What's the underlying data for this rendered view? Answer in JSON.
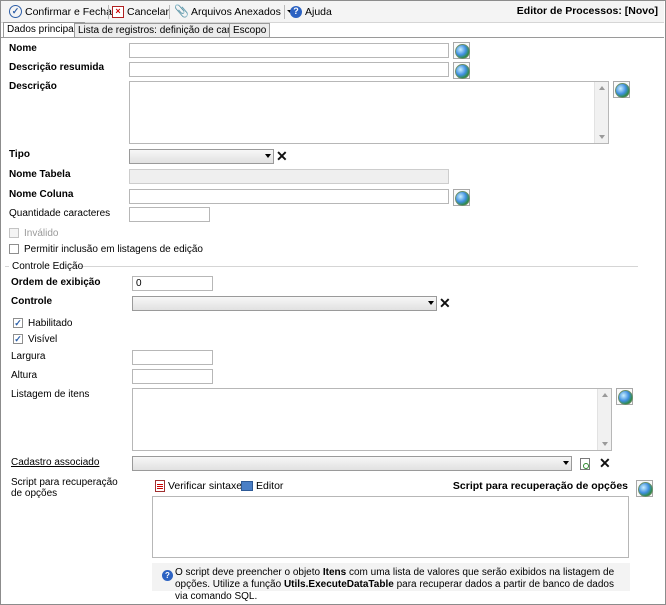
{
  "toolbar": {
    "confirm_label": "Confirmar e Fechar",
    "cancel_label": "Cancelar",
    "attachments_label": "Arquivos Anexados",
    "help_label": "Ajuda",
    "editor_title": "Editor de Processos: [Novo]"
  },
  "tabs": [
    {
      "label": "Dados principais",
      "active": true
    },
    {
      "label": "Lista de registros: definição de campos",
      "active": false
    },
    {
      "label": "Escopo",
      "active": false
    }
  ],
  "form": {
    "nome_label": "Nome",
    "nome_value": "",
    "descricao_resumida_label": "Descrição resumida",
    "descricao_resumida_value": "",
    "descricao_label": "Descrição",
    "descricao_value": "",
    "tipo_label": "Tipo",
    "tipo_value": "",
    "nome_tabela_label": "Nome Tabela",
    "nome_tabela_value": "",
    "nome_coluna_label": "Nome Coluna",
    "nome_coluna_value": "",
    "quantidade_label": "Quantidade caracteres",
    "quantidade_value": "",
    "invalido_label": "Inválido",
    "invalido_checked": false,
    "permitir_label": "Permitir inclusão em listagens de edição",
    "permitir_checked": false
  },
  "controle_edicao": {
    "group_label": "Controle Edição",
    "ordem_label": "Ordem de exibição",
    "ordem_value": "0",
    "controle_label": "Controle",
    "controle_value": "",
    "habilitado_label": "Habilitado",
    "habilitado_checked": true,
    "visivel_label": "Visível",
    "visivel_checked": true,
    "largura_label": "Largura",
    "largura_value": "",
    "altura_label": "Altura",
    "altura_value": "",
    "listagem_label": "Listagem de itens",
    "listagem_value": "",
    "cadastro_label": "Cadastro associado",
    "cadastro_value": "",
    "script_label": "Script para recuperação de opções"
  },
  "script_editor": {
    "verify_label": "Verificar sintaxe",
    "editor_label": "Editor",
    "header_title": "Script para recuperação de opções",
    "content": "",
    "info_part1": "O script deve preencher o objeto ",
    "info_bold1": "Itens",
    "info_part2": " com uma lista de valores que serão exibidos na listagem de opções. Utilize a função ",
    "info_bold2": "Utils.ExecuteDataTable",
    "info_part3": " para recuperar dados a partir de banco de dados via comando SQL."
  },
  "icons": {
    "confirm": "check-circle-icon",
    "cancel": "cancel-x-icon",
    "attachments": "paperclip-icon",
    "help": "help-icon",
    "translate": "globe-icon",
    "clear": "clear-x-icon",
    "lookup": "lookup-icon",
    "verify": "verify-syntax-icon",
    "editor": "editor-icon",
    "info": "info-icon"
  }
}
